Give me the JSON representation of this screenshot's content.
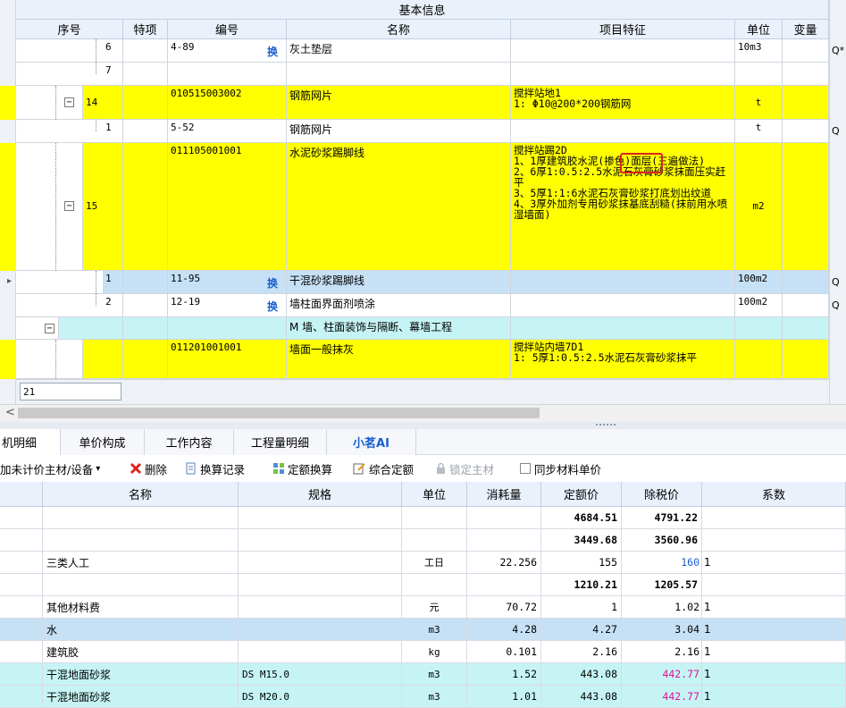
{
  "top_grid": {
    "group_header": "基本信息",
    "columns": [
      "序号",
      "特项",
      "编号",
      "名称",
      "项目特征",
      "单位",
      "变量"
    ],
    "rows": [
      {
        "seq": "6",
        "code": "4-89",
        "huan": "换",
        "name": "灰土垫层",
        "feature": "",
        "unit": "10m3",
        "extra": "Q*"
      },
      {
        "seq": "7",
        "code": "",
        "name": "",
        "feature": "",
        "unit": "",
        "extra": ""
      },
      {
        "seq": "14",
        "code": "010515003002",
        "name": "钢筋网片",
        "feature": "搅拌站地1\n1: Φ10@200*200钢筋网",
        "unit": "t",
        "extra": ""
      },
      {
        "seq": "1",
        "code": "5-52",
        "name": "钢筋网片",
        "feature": "",
        "unit": "t",
        "extra": "Q"
      },
      {
        "seq": "15",
        "code": "011105001001",
        "name": "水泥砂浆踢脚线",
        "feature": "搅拌站踢2D\n1、1厚建筑胶水泥(掺色)面层(三遍做法)\n2、6厚1:0.5:2.5水泥石灰膏砂浆抹面压实赶平\n3、5厚1:1:6水泥石灰膏砂浆打底划出纹道\n4、3厚外加剂专用砂浆抹基底刮糙(抹前用水喷湿墙面)",
        "unit": "m2",
        "extra": ""
      },
      {
        "seq": "1",
        "code": "11-95",
        "huan": "换",
        "name": "干混砂浆踢脚线",
        "feature": "",
        "unit": "100m2",
        "extra": "Q"
      },
      {
        "seq": "2",
        "code": "12-19",
        "huan": "换",
        "name": "墙柱面界面剂喷涂",
        "feature": "",
        "unit": "100m2",
        "extra": "Q"
      },
      {
        "seq": "",
        "code": "",
        "name": "M 墙、柱面装饰与隔断、幕墙工程",
        "feature": "",
        "unit": "",
        "extra": ""
      },
      {
        "seq": "",
        "code": "011201001001",
        "name": "墙面一般抹灰",
        "feature": "搅拌站内墙7D1\n1: 5厚1:0.5:2.5水泥石灰膏砂浆抹平",
        "unit": "",
        "extra": ""
      }
    ],
    "input_value": "21",
    "highlight": "(掺色)",
    "expander_minus": "−",
    "scroll_left": "<",
    "row_pointer": "▸"
  },
  "tabs": [
    "机明细",
    "单价构成",
    "工作内容",
    "工程量明细",
    "小茗AI"
  ],
  "toolbar": {
    "add_main": "加未计价主材/设备",
    "dropdown": "▾",
    "delete": "删除",
    "replace_record": "换算记录",
    "quota_replace": "定额换算",
    "comprehensive_quota": "综合定额",
    "lock_main": "锁定主材",
    "sync_price": "同步材料单价"
  },
  "bottom_grid": {
    "columns": [
      "名称",
      "规格",
      "单位",
      "消耗量",
      "定额价",
      "除税价",
      "系数"
    ],
    "rows": [
      {
        "name": "",
        "spec": "",
        "unit": "",
        "qty": "",
        "quota": "4684.51",
        "tax": "4791.22",
        "coef": "",
        "bold": true
      },
      {
        "name": "",
        "spec": "",
        "unit": "",
        "qty": "",
        "quota": "3449.68",
        "tax": "3560.96",
        "coef": "",
        "bold": true
      },
      {
        "name": "三类人工",
        "spec": "",
        "unit": "工日",
        "qty": "22.256",
        "quota": "155",
        "tax": "160",
        "coef": "1"
      },
      {
        "name": "",
        "spec": "",
        "unit": "",
        "qty": "",
        "quota": "1210.21",
        "tax": "1205.57",
        "coef": "",
        "bold": true
      },
      {
        "name": "其他材料费",
        "spec": "",
        "unit": "元",
        "qty": "70.72",
        "quota": "1",
        "tax": "1.02",
        "coef": "1"
      },
      {
        "name": "水",
        "spec": "",
        "unit": "m3",
        "qty": "4.28",
        "quota": "4.27",
        "tax": "3.04",
        "coef": "1"
      },
      {
        "name": "建筑胶",
        "spec": "",
        "unit": "kg",
        "qty": "0.101",
        "quota": "2.16",
        "tax": "2.16",
        "coef": "1"
      },
      {
        "name": "干混地面砂浆",
        "spec": "DS M15.0",
        "unit": "m3",
        "qty": "1.52",
        "quota": "443.08",
        "tax": "442.77",
        "coef": "1"
      },
      {
        "name": "干混地面砂浆",
        "spec": "DS M20.0",
        "unit": "m3",
        "qty": "1.01",
        "quota": "443.08",
        "tax": "442.77",
        "coef": "1"
      }
    ]
  },
  "colors": {
    "yellow": "#ffff00",
    "light_blue": "#c6e0f5",
    "cyan": "#c6f4f4",
    "red": "#e0231b",
    "blue_text": "#1a5fd0",
    "magenta_text": "#e0109a"
  }
}
